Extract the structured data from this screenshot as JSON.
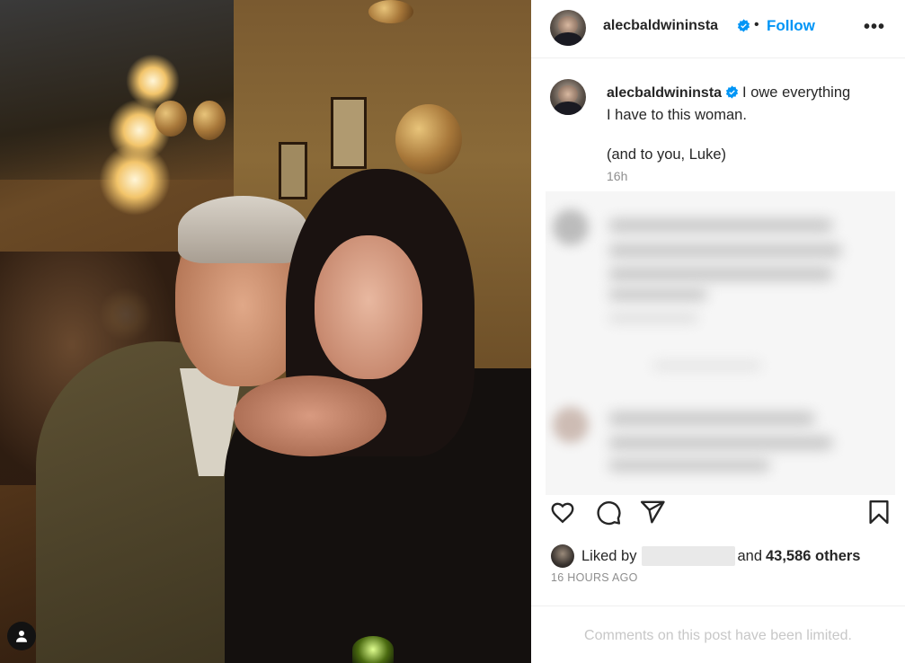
{
  "post": {
    "username": "alecbaldwininsta",
    "verified": true,
    "separator": "•",
    "follow_label": "Follow",
    "more_icon": "more-horizontal-icon",
    "caption_line1": "I owe everything",
    "caption_line2": "I have to this woman.",
    "caption_line3": "(and to you, Luke)",
    "caption_time": "16h",
    "liked_by_prefix": "Liked by",
    "liked_by_and": "and",
    "likes_count": "43,586 others",
    "posted_ago": "16 HOURS AGO",
    "comments_limited": "Comments on this post have been limited."
  },
  "colors": {
    "accent_blue": "#0095f6",
    "text_primary": "#262626",
    "text_secondary": "#8e8e8e",
    "text_muted": "#c7c7c7"
  },
  "actions": {
    "like_icon": "heart-icon",
    "comment_icon": "comment-icon",
    "share_icon": "send-icon",
    "save_icon": "bookmark-icon"
  }
}
